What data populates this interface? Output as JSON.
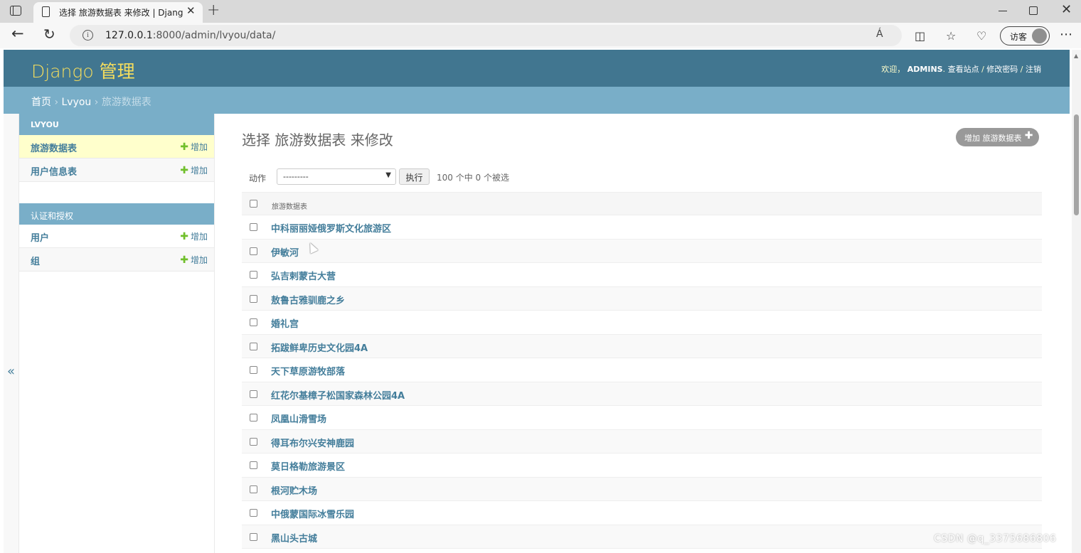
{
  "browser": {
    "tab_title": "选择 旅游数据表 来修改 | Django",
    "url_host": "127.0.0.1",
    "url_rest": ":8000/admin/lvyou/data/",
    "read_aloud": "Á",
    "guest_label": "访客"
  },
  "header": {
    "branding": "Django 管理",
    "welcome": "欢迎，",
    "username": "ADMINS",
    "view_site": "查看站点",
    "change_password": "修改密码",
    "logout": "注销",
    "sep": " / "
  },
  "breadcrumbs": {
    "home": "首页",
    "app": "Lvyou",
    "current": "旅游数据表",
    "sep": " › "
  },
  "sidebar": {
    "toggle": "«",
    "modules": [
      {
        "caption": "LVYOU",
        "items": [
          {
            "name": "旅游数据表",
            "add": "增加"
          },
          {
            "name": "用户信息表",
            "add": "增加"
          }
        ]
      },
      {
        "caption": "认证和授权",
        "items": [
          {
            "name": "用户",
            "add": "增加"
          },
          {
            "name": "组",
            "add": "增加"
          }
        ]
      }
    ]
  },
  "content": {
    "title": "选择 旅游数据表 来修改",
    "add_button": "增加 旅游数据表",
    "actions": {
      "label": "动作",
      "select_value": "---------",
      "go": "执行",
      "counter": "100 个中 0 个被选"
    },
    "column_header": "旅游数据表",
    "rows": [
      "中科丽丽娅俄罗斯文化旅游区",
      "伊敏河",
      "弘吉剌蒙古大营",
      "敖鲁古雅驯鹿之乡",
      "婚礼宫",
      "拓跋鲜卑历史文化园4A",
      "天下草原游牧部落",
      "红花尔基樟子松国家森林公园4A",
      "凤凰山滑雪场",
      "得耳布尔兴安神鹿园",
      "莫日格勒旅游景区",
      "根河贮木场",
      "中俄蒙国际冰雪乐园",
      "黑山头古城"
    ]
  },
  "watermark": "CSDN @q_3375686806",
  "colors": {
    "header_bg": "#417690",
    "breadcrumb_bg": "#79aec8",
    "branding": "#f5dd5d",
    "link": "#447e9b",
    "add_plus": "#70bf2b",
    "current_row": "#ffffcc"
  }
}
